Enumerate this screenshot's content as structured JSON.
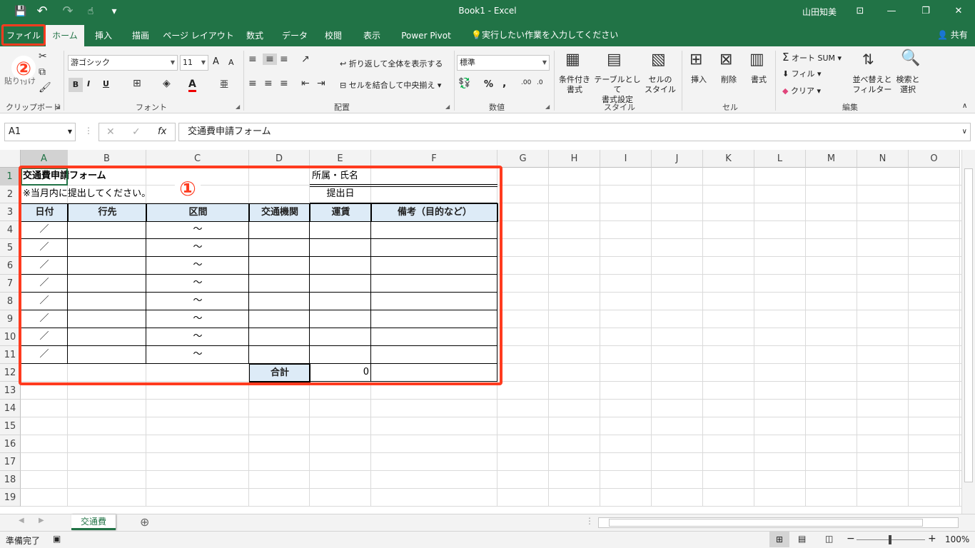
{
  "window": {
    "title": "Book1  -  Excel",
    "user": "山田知美",
    "buttons": {
      "ribbon_options": "⊡",
      "minimize": "—",
      "restore": "❐",
      "close": "✕"
    }
  },
  "qat": {
    "save": "💾",
    "undo": "↶",
    "redo": "↷",
    "touch": "☝",
    "customize": "▾"
  },
  "tabs": {
    "file": "ファイル",
    "items": [
      "ホーム",
      "挿入",
      "描画",
      "ページ レイアウト",
      "数式",
      "データ",
      "校閲",
      "表示",
      "Power Pivot"
    ],
    "tell_me": "実行したい作業を入力してください",
    "share": "共有"
  },
  "ribbon": {
    "clipboard": {
      "label": "クリップボード",
      "paste": "貼り付け"
    },
    "font": {
      "label": "フォント",
      "name": "游ゴシック",
      "size": "11",
      "bold": "B",
      "italic": "I",
      "underline": "U",
      "grow": "A",
      "shrink": "A",
      "color_a": "A"
    },
    "alignment": {
      "label": "配置",
      "wrap": "折り返して全体を表示する",
      "merge": "セルを結合して中央揃え"
    },
    "number": {
      "label": "数値",
      "format": "標準",
      "percent": "%",
      "comma": ","
    },
    "styles": {
      "label": "スタイル",
      "cond": [
        "条件付き",
        "書式"
      ],
      "table": [
        "テーブルとして",
        "書式設定"
      ],
      "cell": [
        "セルの",
        "スタイル"
      ]
    },
    "cells": {
      "label": "セル",
      "insert": "挿入",
      "delete": "削除",
      "format": "書式"
    },
    "editing": {
      "label": "編集",
      "autosum": "オート SUM",
      "fill": "フィル",
      "clear": "クリア",
      "sort": [
        "並べ替えと",
        "フィルター"
      ],
      "find": [
        "検索と",
        "選択"
      ]
    }
  },
  "formula_bar": {
    "name_box": "A1",
    "cancel": "✕",
    "enter": "✓",
    "fx": "fx",
    "content": "交通費申請フォーム"
  },
  "columns": [
    "A",
    "B",
    "C",
    "D",
    "E",
    "F",
    "G",
    "H",
    "I",
    "J",
    "K",
    "L",
    "M",
    "N",
    "O"
  ],
  "rows": [
    "1",
    "2",
    "3",
    "4",
    "5",
    "6",
    "7",
    "8",
    "9",
    "10",
    "11",
    "12",
    "13",
    "14",
    "15",
    "16",
    "17",
    "18",
    "19"
  ],
  "sheet": {
    "title": "交通費申請フォーム",
    "note": "※当月内に提出してください。",
    "affiliation_label": "所属・氏名",
    "submit_label": "提出日",
    "headers": [
      "日付",
      "行先",
      "区間",
      "交通機関",
      "運賃",
      "備考（目的など）"
    ],
    "date_mark": "／",
    "range_mark": "～",
    "total_label": "合計",
    "total_value": "0"
  },
  "annotations": {
    "one": "①",
    "two": "②"
  },
  "sheet_tabs": {
    "active": "交通費",
    "add": "⊕"
  },
  "status": {
    "ready": "準備完了",
    "zoom": "100%"
  },
  "colors": {
    "brand": "#217346",
    "header_fill": "#ddebf7",
    "annotation": "#ff3b1f"
  }
}
